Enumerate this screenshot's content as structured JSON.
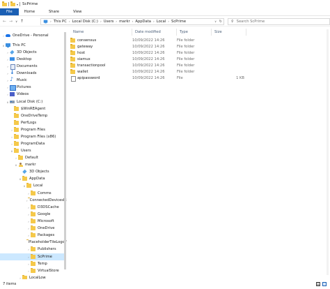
{
  "window": {
    "title": "ScPrime"
  },
  "ribbon": {
    "tabs": [
      "File",
      "Home",
      "Share",
      "View"
    ]
  },
  "address": {
    "crumbs": [
      "This PC",
      "Local Disk (C:)",
      "Users",
      "markr",
      "AppData",
      "Local",
      "ScPrime"
    ],
    "search_placeholder": "Search ScPrime"
  },
  "columns": {
    "name": "Name",
    "date": "Date modified",
    "type": "Type",
    "size": "Size"
  },
  "files": [
    {
      "name": "consensus",
      "date": "10/09/2022 14:26",
      "type": "File folder",
      "size": "",
      "kind": "folder"
    },
    {
      "name": "gateway",
      "date": "10/09/2022 14:26",
      "type": "File folder",
      "size": "",
      "kind": "folder"
    },
    {
      "name": "host",
      "date": "10/09/2022 14:26",
      "type": "File folder",
      "size": "",
      "kind": "folder"
    },
    {
      "name": "siamux",
      "date": "10/09/2022 14:26",
      "type": "File folder",
      "size": "",
      "kind": "folder"
    },
    {
      "name": "transactionpool",
      "date": "10/09/2022 14:26",
      "type": "File folder",
      "size": "",
      "kind": "folder"
    },
    {
      "name": "wallet",
      "date": "10/09/2022 14:26",
      "type": "File folder",
      "size": "",
      "kind": "folder"
    },
    {
      "name": "apipassword",
      "date": "10/09/2022 14:26",
      "type": "File",
      "size": "1 KB",
      "kind": "file"
    }
  ],
  "nav": [
    {
      "label": "OneDrive - Personal",
      "icon": "cloud",
      "chev": ">"
    },
    {
      "label": "This PC",
      "icon": "pc",
      "chev": "v"
    },
    {
      "label": "3D Objects",
      "icon": "cube",
      "chev": ">"
    },
    {
      "label": "Desktop",
      "icon": "desk",
      "chev": ">"
    },
    {
      "label": "Documents",
      "icon": "doc",
      "chev": ">"
    },
    {
      "label": "Downloads",
      "icon": "dl",
      "chev": ">"
    },
    {
      "label": "Music",
      "icon": "music",
      "chev": ">"
    },
    {
      "label": "Pictures",
      "icon": "pic",
      "chev": ">"
    },
    {
      "label": "Videos",
      "icon": "vid",
      "chev": ">"
    },
    {
      "label": "Local Disk (C:)",
      "icon": "drive",
      "chev": "v"
    },
    {
      "label": "$WinREAgent",
      "icon": "folder",
      "chev": ""
    },
    {
      "label": "OneDriveTemp",
      "icon": "folder",
      "chev": ""
    },
    {
      "label": "PerfLogs",
      "icon": "folder",
      "chev": ""
    },
    {
      "label": "Program Files",
      "icon": "folder",
      "chev": ">"
    },
    {
      "label": "Program Files (x86)",
      "icon": "folder",
      "chev": ">"
    },
    {
      "label": "ProgramData",
      "icon": "folder",
      "chev": ">"
    },
    {
      "label": "Users",
      "icon": "folder",
      "chev": "v"
    },
    {
      "label": "Default",
      "icon": "folder",
      "chev": ">"
    },
    {
      "label": "markr",
      "icon": "user",
      "chev": "v"
    },
    {
      "label": "3D Objects",
      "icon": "cube",
      "chev": ""
    },
    {
      "label": "AppData",
      "icon": "folder",
      "chev": "v"
    },
    {
      "label": "Local",
      "icon": "folder",
      "chev": "v"
    },
    {
      "label": "Comms",
      "icon": "folder",
      "chev": ">"
    },
    {
      "label": "ConnectedDevicesPla",
      "icon": "folder",
      "chev": ">"
    },
    {
      "label": "D3DSCache",
      "icon": "folder",
      "chev": ">"
    },
    {
      "label": "Google",
      "icon": "folder",
      "chev": ">"
    },
    {
      "label": "Microsoft",
      "icon": "folder",
      "chev": ">"
    },
    {
      "label": "OneDrive",
      "icon": "folder",
      "chev": ">"
    },
    {
      "label": "Packages",
      "icon": "folder",
      "chev": ">"
    },
    {
      "label": "PlaceholderTileLogoF",
      "icon": "folder",
      "chev": ""
    },
    {
      "label": "Publishers",
      "icon": "folder",
      "chev": ">"
    },
    {
      "label": "ScPrime",
      "icon": "folder",
      "chev": ">",
      "selected": true
    },
    {
      "label": "Temp",
      "icon": "folder",
      "chev": ">"
    },
    {
      "label": "VirtualStore",
      "icon": "folder",
      "chev": ">"
    },
    {
      "label": "LocalLow",
      "icon": "folder",
      "chev": ">"
    }
  ],
  "status": {
    "count": "7 items"
  },
  "colors": {
    "accent": "#1a5fb4",
    "selection": "#cce8ff",
    "folder": "#f5c94a"
  }
}
